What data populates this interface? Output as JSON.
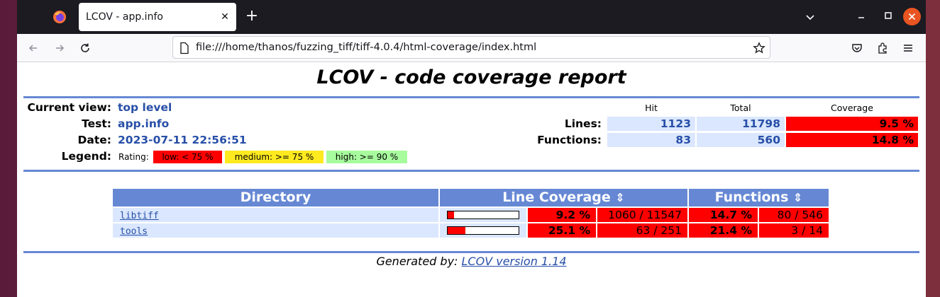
{
  "browser": {
    "tab_title": "LCOV - app.info",
    "tab_close": "✕",
    "new_tab": "+",
    "url": "file:///home/thanos/fuzzing_tiff/tiff-4.0.4/html-coverage/index.html"
  },
  "report": {
    "title": "LCOV - code coverage report",
    "current_view_label": "Current view:",
    "current_view_value": "top level",
    "test_label": "Test:",
    "test_value": "app.info",
    "date_label": "Date:",
    "date_value": "2023-07-11 22:56:51",
    "legend_label": "Legend:",
    "rating_label": "Rating:",
    "legend_low": "low: < 75 %",
    "legend_medium": "medium: >= 75 %",
    "legend_high": "high: >= 90 %",
    "col_hit": "Hit",
    "col_total": "Total",
    "col_coverage": "Coverage",
    "lines_label": "Lines:",
    "lines_hit": "1123",
    "lines_total": "11798",
    "lines_coverage": "9.5 %",
    "functions_label": "Functions:",
    "functions_hit": "83",
    "functions_total": "560",
    "functions_coverage": "14.8 %"
  },
  "table": {
    "headers": {
      "directory": "Directory",
      "line_coverage": "Line Coverage",
      "functions": "Functions",
      "sort_icon": "⇕"
    },
    "rows": [
      {
        "name": "libtiff",
        "line_fraction": 0.092,
        "line_pct": "9.2 %",
        "line_counts": "1060 / 11547",
        "func_pct": "14.7 %",
        "func_counts": "80 / 546"
      },
      {
        "name": "tools",
        "line_fraction": 0.251,
        "line_pct": "25.1 %",
        "line_counts": "63 / 251",
        "func_pct": "21.4 %",
        "func_counts": "3 / 14"
      }
    ]
  },
  "footer": {
    "prefix": "Generated by: ",
    "link": "LCOV version 1.14"
  },
  "colors": {
    "accent": "#6688d4",
    "value_blue": "#284fa8",
    "low": "#ff0000",
    "medium": "#ffea20",
    "high": "#a7fc9d",
    "cell_light": "#dae7fe"
  }
}
